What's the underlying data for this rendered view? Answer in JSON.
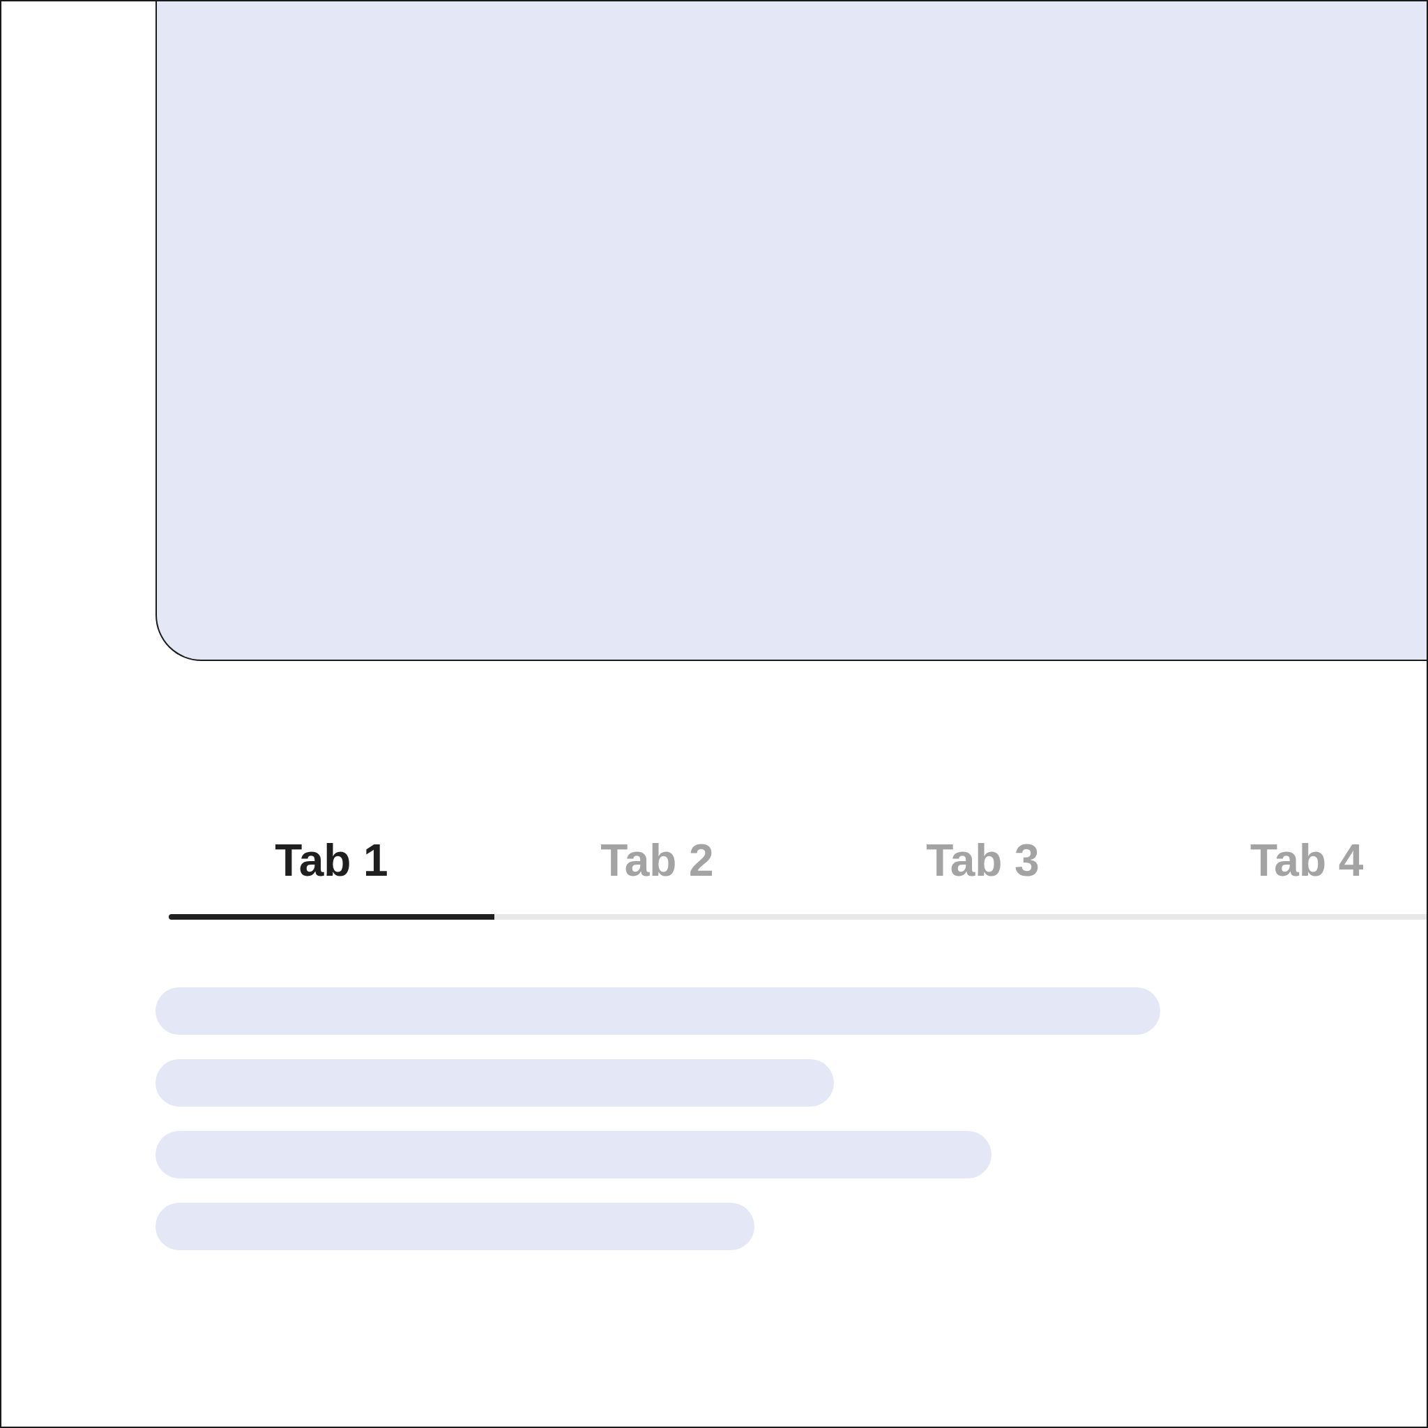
{
  "tabs": [
    {
      "label": "Tab 1",
      "selected": true
    },
    {
      "label": "Tab 2",
      "selected": false
    },
    {
      "label": "Tab 3",
      "selected": false
    },
    {
      "label": "Tab 4",
      "selected": false
    }
  ]
}
